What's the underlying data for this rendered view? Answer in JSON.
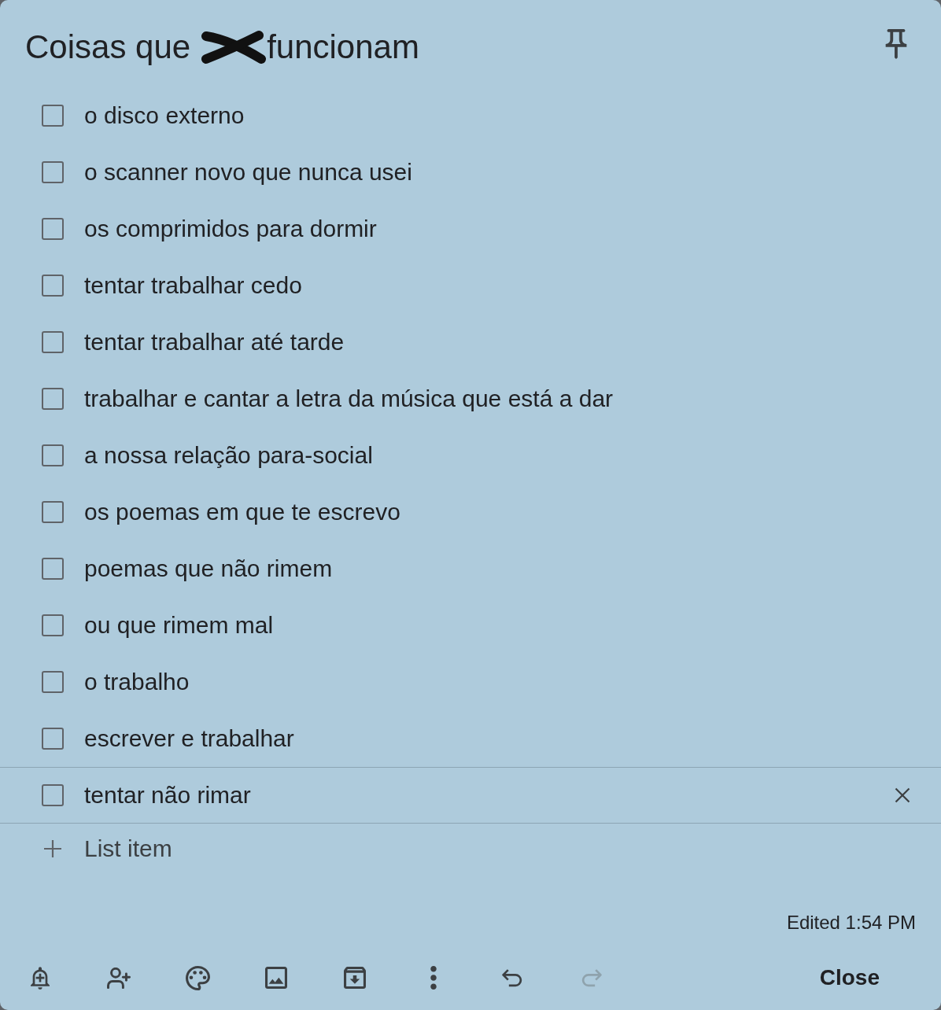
{
  "title": [
    {
      "kind": "text",
      "text": "Coisas que"
    },
    {
      "kind": "scribble"
    },
    {
      "kind": "text",
      "text": "funcionam"
    }
  ],
  "items": [
    {
      "text": "o disco externo",
      "checked": false,
      "focused": false
    },
    {
      "text": "o scanner novo que nunca usei",
      "checked": false,
      "focused": false
    },
    {
      "text": "os comprimidos para dormir",
      "checked": false,
      "focused": false
    },
    {
      "text": "tentar trabalhar cedo",
      "checked": false,
      "focused": false
    },
    {
      "text": "tentar trabalhar até tarde",
      "checked": false,
      "focused": false
    },
    {
      "text": "trabalhar e cantar a letra da música que está a dar",
      "checked": false,
      "focused": false
    },
    {
      "text": "a nossa relação para-social",
      "checked": false,
      "focused": false
    },
    {
      "text": "os poemas em que te escrevo",
      "checked": false,
      "focused": false
    },
    {
      "text": "poemas que não rimem",
      "checked": false,
      "focused": false
    },
    {
      "text": "ou que rimem mal",
      "checked": false,
      "focused": false
    },
    {
      "text": "o trabalho",
      "checked": false,
      "focused": false
    },
    {
      "text": "escrever e trabalhar",
      "checked": false,
      "focused": false
    },
    {
      "text": "tentar não rimar",
      "checked": false,
      "focused": true
    }
  ],
  "new_item": {
    "placeholder": "List item"
  },
  "edited": "Edited 1:54 PM",
  "toolbar": {
    "undo": {
      "disabled": false
    },
    "redo": {
      "disabled": true
    }
  },
  "close_button": "Close"
}
